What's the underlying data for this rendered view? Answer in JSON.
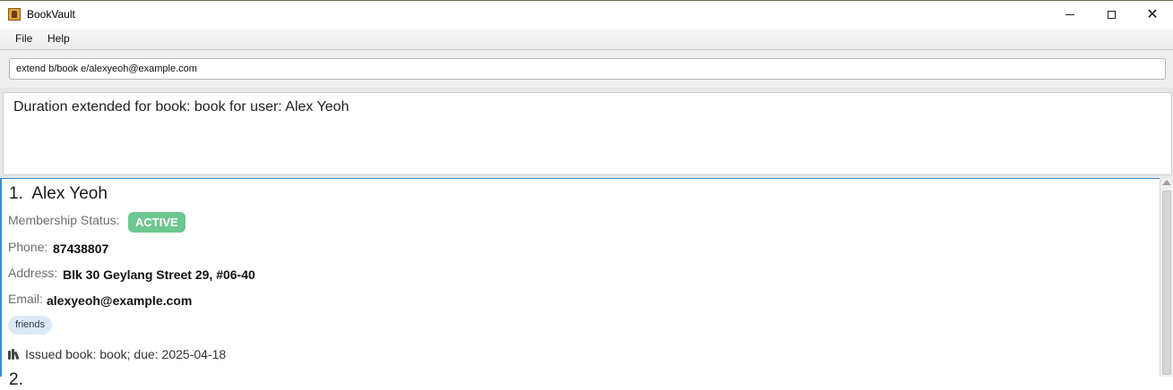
{
  "window": {
    "title": "BookVault",
    "controls": {
      "minimize_icon": "minimize-icon",
      "maximize_icon": "maximize-icon",
      "close_icon": "close-icon"
    }
  },
  "menu": {
    "items": [
      "File",
      "Help"
    ]
  },
  "command": {
    "value": "extend b/book e/alexyeoh@example.com"
  },
  "result": {
    "message": "Duration extended for book: book for user: Alex Yeoh"
  },
  "persons": [
    {
      "index": "1.",
      "name": "Alex Yeoh",
      "membership_label": "Membership Status:",
      "membership_status": "ACTIVE",
      "phone_label": "Phone:",
      "phone": "87438807",
      "address_label": "Address:",
      "address": "Blk 30 Geylang Street 29, #06-40",
      "email_label": "Email:",
      "email": "alexyeoh@example.com",
      "tags": [
        "friends"
      ],
      "issued": "Issued book: book; due: 2025-04-18"
    }
  ],
  "colors": {
    "status_active": "#6dc78f",
    "tag_bg": "#dde9f7",
    "list_border": "#3d8fcf"
  }
}
